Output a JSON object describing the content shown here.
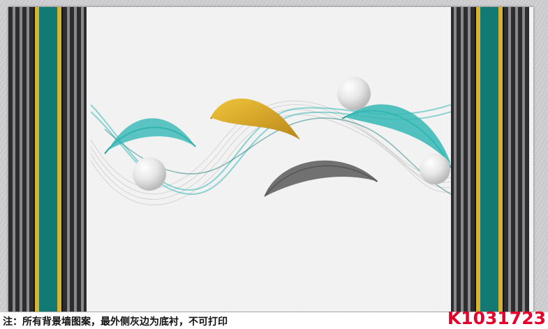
{
  "note": "注：所有背景墙图案，最外侧灰边为底衬，不可打印",
  "code": "K1031723",
  "colors": {
    "background_texture": "#cdcdd0",
    "canvas": "#f2f2f2",
    "stripe_dark": "#2d2d2f",
    "stripe_gray": "#8a8a8c",
    "teal": "#127a72",
    "gold": "#d8b332",
    "feather_teal": "#35b8b6",
    "feather_gold": "#d9a722",
    "feather_gray": "#5a5a5a",
    "code_red": "#e5002b"
  },
  "icons": [
    "feather-teal-icon",
    "feather-gold-icon",
    "feather-gray-icon",
    "pearl-icon"
  ]
}
